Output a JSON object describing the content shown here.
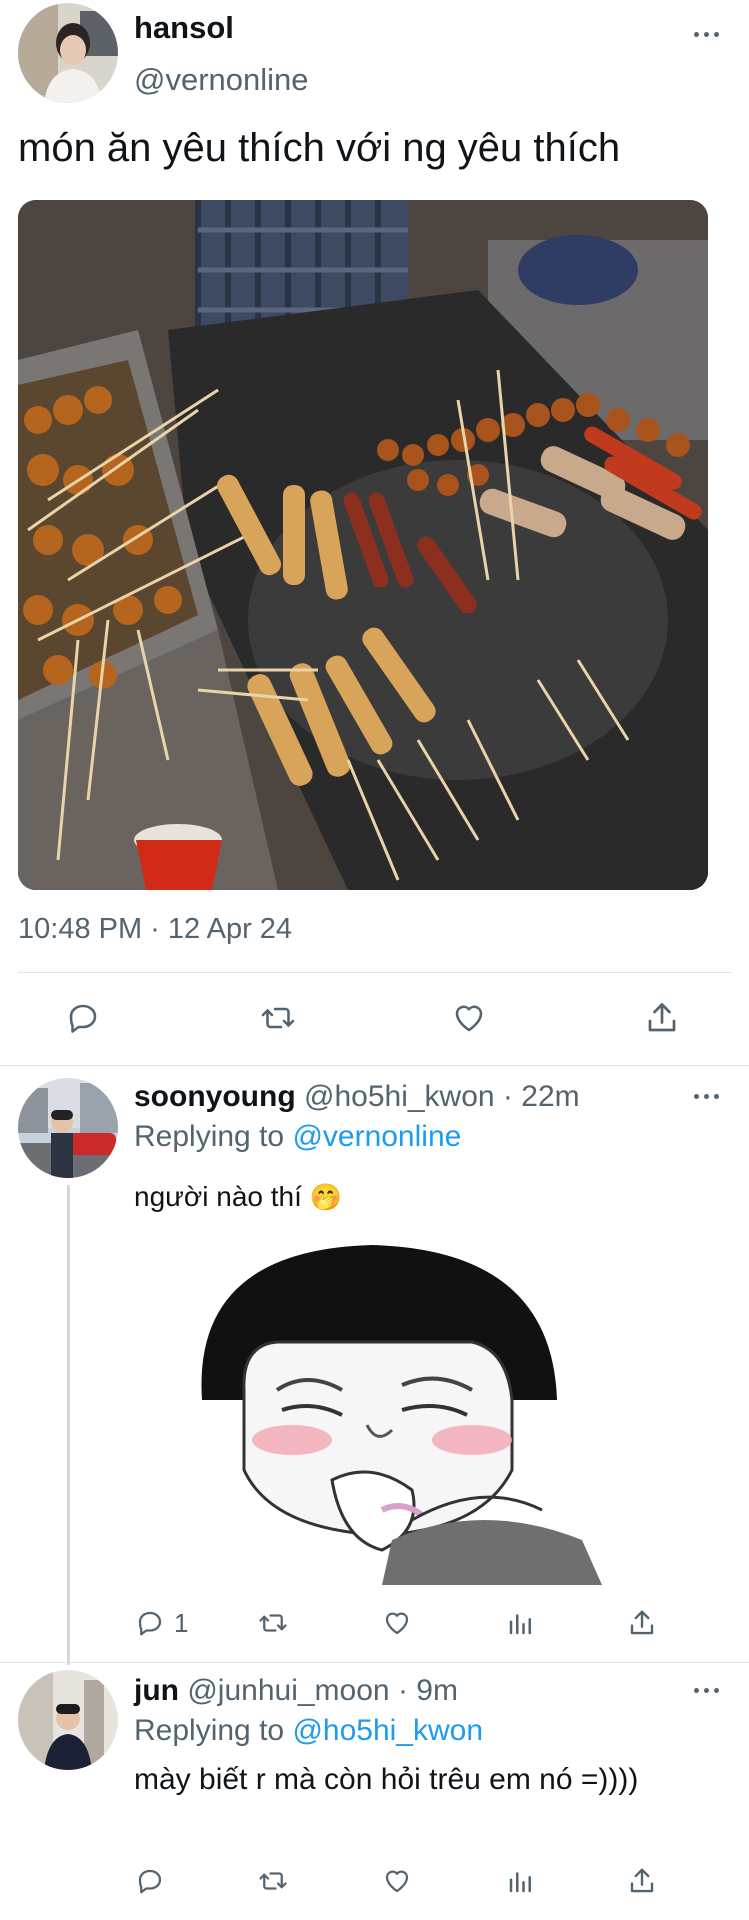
{
  "tweet": {
    "display_name": "hansol",
    "handle": "@vernonline",
    "text": "món ăn yêu thích với ng yêu thích",
    "timestamp": "10:48 PM · 12 Apr 24",
    "avatar_icon": "profile-photo",
    "image_icon": "street-food-skewers-photo"
  },
  "replies": [
    {
      "display_name": "soonyoung",
      "handle": "@ho5hi_kwon",
      "separator": "·",
      "age": "22m",
      "replying_label": "Replying to",
      "replying_handle": "@vernonline",
      "text": "người nào thí",
      "emoji": "🤭",
      "image_icon": "blushing-cartoon-sticker",
      "reply_count": "1"
    },
    {
      "display_name": "jun",
      "handle": "@junhui_moon",
      "separator": "·",
      "age": "9m",
      "replying_label": "Replying to",
      "replying_handle": "@ho5hi_kwon",
      "text": "mày biết r mà còn hỏi trêu em nó =))))"
    }
  ],
  "colors": {
    "text": "#0f1419",
    "secondary": "#536471",
    "link": "#1d9bf0",
    "divider": "#e1e5e8"
  }
}
